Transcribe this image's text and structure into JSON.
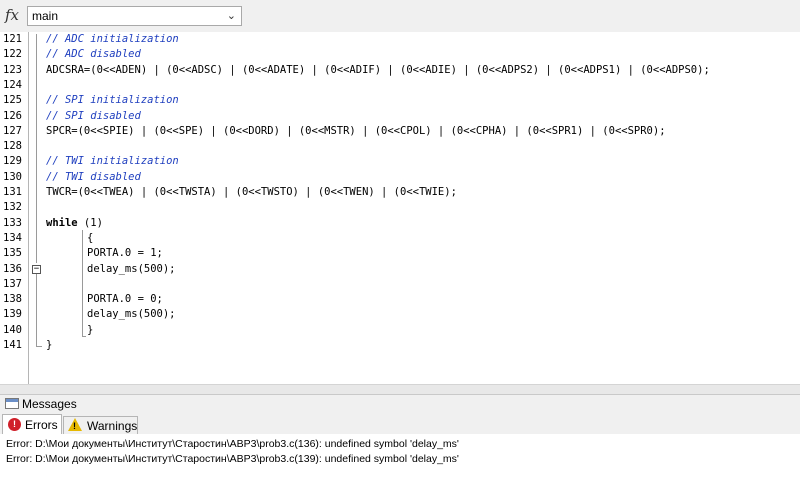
{
  "toolbar": {
    "fx_symbol": "fx",
    "function_select_value": "main"
  },
  "editor": {
    "lines": [
      {
        "n": "121",
        "text": "// ADC initialization",
        "type": "comment"
      },
      {
        "n": "122",
        "text": "// ADC disabled",
        "type": "comment"
      },
      {
        "n": "123",
        "text": "ADCSRA=(0<<ADEN) | (0<<ADSC) | (0<<ADATE) | (0<<ADIF) | (0<<ADIE) | (0<<ADPS2) | (0<<ADPS1) | (0<<ADPS0);",
        "type": "code"
      },
      {
        "n": "124",
        "text": "",
        "type": "code"
      },
      {
        "n": "125",
        "text": "// SPI initialization",
        "type": "comment"
      },
      {
        "n": "126",
        "text": "// SPI disabled",
        "type": "comment"
      },
      {
        "n": "127",
        "text": "SPCR=(0<<SPIE) | (0<<SPE) | (0<<DORD) | (0<<MSTR) | (0<<CPOL) | (0<<CPHA) | (0<<SPR1) | (0<<SPR0);",
        "type": "code"
      },
      {
        "n": "128",
        "text": "",
        "type": "code"
      },
      {
        "n": "129",
        "text": "// TWI initialization",
        "type": "comment"
      },
      {
        "n": "130",
        "text": "// TWI disabled",
        "type": "comment"
      },
      {
        "n": "131",
        "text": "TWCR=(0<<TWEA) | (0<<TWSTA) | (0<<TWSTO) | (0<<TWEN) | (0<<TWIE);",
        "type": "code"
      },
      {
        "n": "132",
        "text": "",
        "type": "code"
      },
      {
        "n": "133",
        "text": "while (1)",
        "type": "keyword"
      },
      {
        "n": "134",
        "text": "{",
        "type": "indented"
      },
      {
        "n": "135",
        "text": "PORTA.0 = 1;",
        "type": "indented"
      },
      {
        "n": "136",
        "text": "delay_ms(500);",
        "type": "indented"
      },
      {
        "n": "137",
        "text": "",
        "type": "indented"
      },
      {
        "n": "138",
        "text": "PORTA.0 = 0;",
        "type": "indented"
      },
      {
        "n": "139",
        "text": "delay_ms(500);",
        "type": "indented"
      },
      {
        "n": "140",
        "text": "}",
        "type": "indented"
      },
      {
        "n": "141",
        "text": "}",
        "type": "code"
      }
    ],
    "fold_marker": "−"
  },
  "messages": {
    "title": "Messages",
    "tabs": {
      "errors": "Errors",
      "warnings": "Warnings"
    },
    "items": [
      "Error: D:\\Мои документы\\Институт\\Старостин\\АВР3\\prob3.c(136): undefined symbol 'delay_ms'",
      "Error: D:\\Мои документы\\Институт\\Старостин\\АВР3\\prob3.c(139): undefined symbol 'delay_ms'"
    ]
  },
  "colors": {
    "comment": "#1f3fbf",
    "error_icon": "#d0202a",
    "warning_icon": "#e6b800"
  }
}
